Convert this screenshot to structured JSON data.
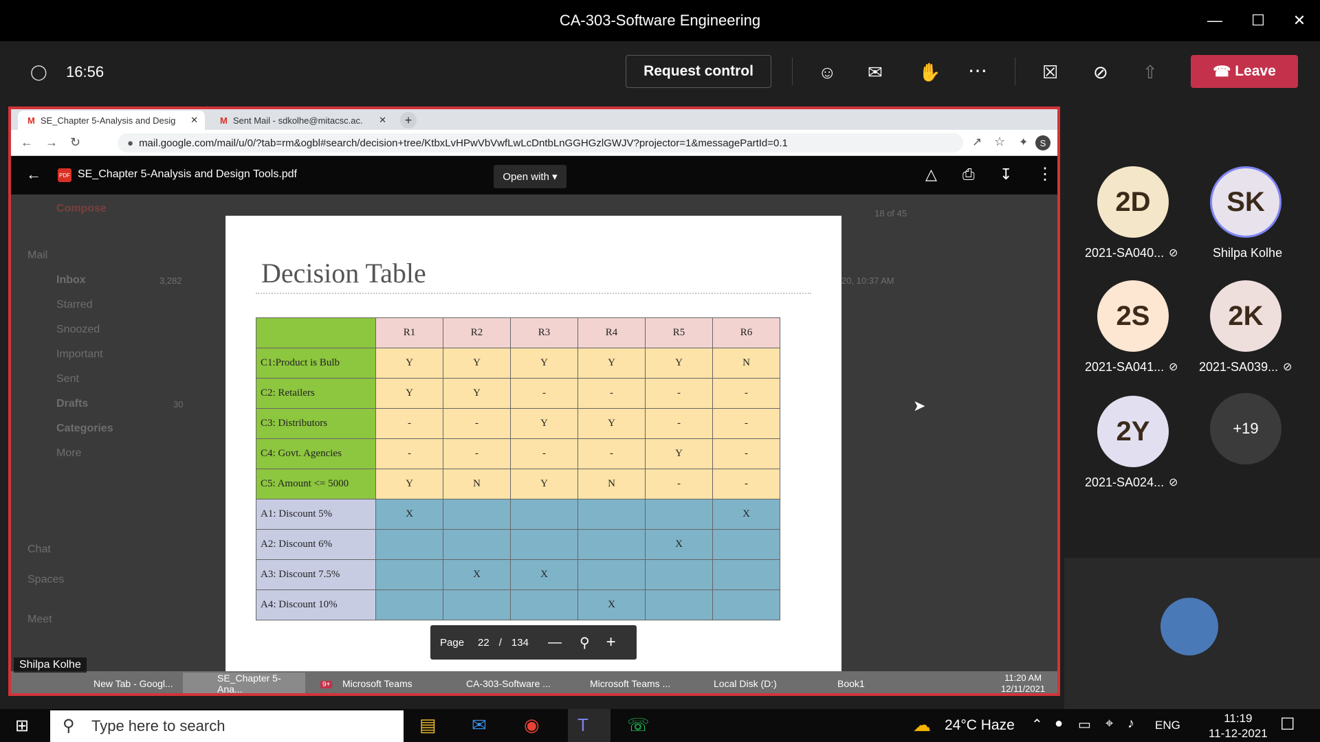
{
  "window": {
    "title": "CA-303-Software Engineering"
  },
  "meeting": {
    "time": "16:56",
    "request_control": "Request control",
    "leave": "Leave"
  },
  "browser": {
    "tabs": [
      {
        "label": "SE_Chapter 5-Analysis and Desig"
      },
      {
        "label": "Sent Mail - sdkolhe@mitacsc.ac."
      }
    ],
    "url": "mail.google.com/mail/u/0/?tab=rm&ogbl#search/decision+tree/KtbxLvHPwVbVwfLwLcDntbLnGGHGzlGWJV?projector=1&messagePartId=0.1",
    "profile_initial": "S"
  },
  "pdf": {
    "filename": "SE_Chapter 5-Analysis and Design Tools.pdf",
    "open_with": "Open with",
    "page_label": "Page",
    "page": "22",
    "sep": "/",
    "total": "134"
  },
  "gmail": {
    "compose": "Compose",
    "mail": "Mail",
    "inbox": "Inbox",
    "inbox_count": "3,282",
    "starred": "Starred",
    "snoozed": "Snoozed",
    "important": "Important",
    "sent": "Sent",
    "drafts": "Drafts",
    "drafts_count": "30",
    "categories": "Categories",
    "more": "More",
    "chat": "Chat",
    "spaces": "Spaces",
    "meet": "Meet",
    "pager": "18 of 45",
    "date": "20, 10:37 AM"
  },
  "slide": {
    "title": "Decision Table",
    "header": [
      "R1",
      "R2",
      "R3",
      "R4",
      "R5",
      "R6"
    ],
    "conditions": [
      {
        "label": "C1:Product is Bulb",
        "cells": [
          "Y",
          "Y",
          "Y",
          "Y",
          "Y",
          "N"
        ]
      },
      {
        "label": "C2: Retailers",
        "cells": [
          "Y",
          "Y",
          "-",
          "-",
          "-",
          "-"
        ]
      },
      {
        "label": "C3: Distributors",
        "cells": [
          "-",
          "-",
          "Y",
          "Y",
          "-",
          "-"
        ]
      },
      {
        "label": "C4: Govt. Agencies",
        "cells": [
          "-",
          "-",
          "-",
          "-",
          "Y",
          "-"
        ]
      },
      {
        "label": "C5: Amount <= 5000",
        "cells": [
          "Y",
          "N",
          "Y",
          "N",
          "-",
          "-"
        ]
      }
    ],
    "actions": [
      {
        "label": "A1: Discount 5%",
        "cells": [
          "X",
          "",
          "",
          "",
          "",
          "X"
        ]
      },
      {
        "label": "A2: Discount 6%",
        "cells": [
          "",
          "",
          "",
          "",
          "X",
          ""
        ]
      },
      {
        "label": "A3: Discount 7.5%",
        "cells": [
          "",
          "X",
          "X",
          "",
          "",
          ""
        ]
      },
      {
        "label": "A4: Discount 10%",
        "cells": [
          "",
          "",
          "",
          "X",
          "",
          ""
        ]
      }
    ]
  },
  "inner_taskbar": {
    "presenter": "Shilpa Kolhe",
    "items": [
      "New Tab - Googl...",
      "SE_Chapter 5-Ana...",
      "Microsoft Teams",
      "CA-303-Software ...",
      "Microsoft Teams ...",
      "Local Disk (D:)",
      "Book1"
    ],
    "time": "11:20 AM",
    "date": "12/11/2021",
    "badge": "9+"
  },
  "participants": [
    {
      "initials": "2D",
      "name": "2021-SA040...",
      "color": "#f4e6c8"
    },
    {
      "initials": "SK",
      "name": "Shilpa Kolhe",
      "color": "#e8e2ec"
    },
    {
      "initials": "2S",
      "name": "2021-SA041...",
      "color": "#fde6d2"
    },
    {
      "initials": "2K",
      "name": "2021-SA039...",
      "color": "#eedfdc"
    },
    {
      "initials": "2Y",
      "name": "2021-SA024...",
      "color": "#e2e0f0"
    },
    {
      "initials": "+19",
      "name": "",
      "color": "#3b3b3b"
    }
  ],
  "taskbar": {
    "search": "Type here to search",
    "weather": "24°C  Haze",
    "lang": "ENG",
    "time": "11:19",
    "date": "11-12-2021"
  }
}
